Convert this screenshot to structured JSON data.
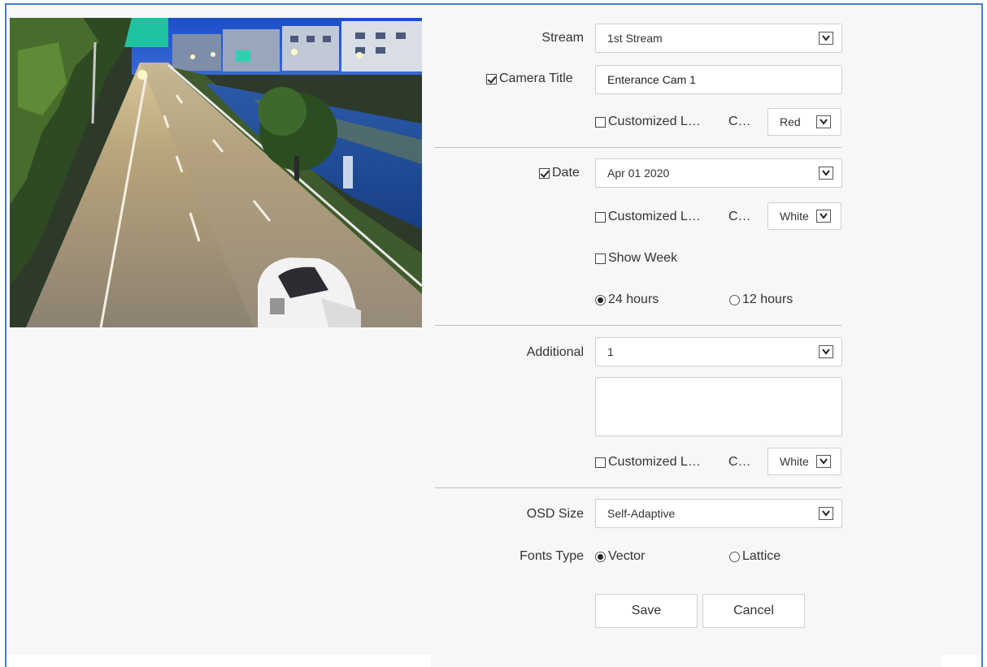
{
  "stream": {
    "label": "Stream",
    "value": "1st Stream"
  },
  "camera_title": {
    "label": "Camera Title",
    "checked": true,
    "value": "Enterance Cam 1",
    "customized_label": "Customized L…",
    "color_label": "C…",
    "color_value": "Red"
  },
  "date": {
    "label": "Date",
    "checked": true,
    "value": "Apr 01 2020",
    "customized_label": "Customized L…",
    "color_label": "C…",
    "color_value": "White",
    "show_week_label": "Show Week",
    "hours24_label": "24 hours",
    "hours12_label": "12 hours"
  },
  "additional": {
    "label": "Additional",
    "value": "1",
    "text": "",
    "customized_label": "Customized L…",
    "color_label": "C…",
    "color_value": "White"
  },
  "osd_size": {
    "label": "OSD Size",
    "value": "Self-Adaptive"
  },
  "fonts_type": {
    "label": "Fonts Type",
    "vector_label": "Vector",
    "lattice_label": "Lattice"
  },
  "buttons": {
    "save": "Save",
    "cancel": "Cancel"
  },
  "colors": {
    "accent_border": "#4a7bd0",
    "panel_bg": "#f7f7f7"
  }
}
